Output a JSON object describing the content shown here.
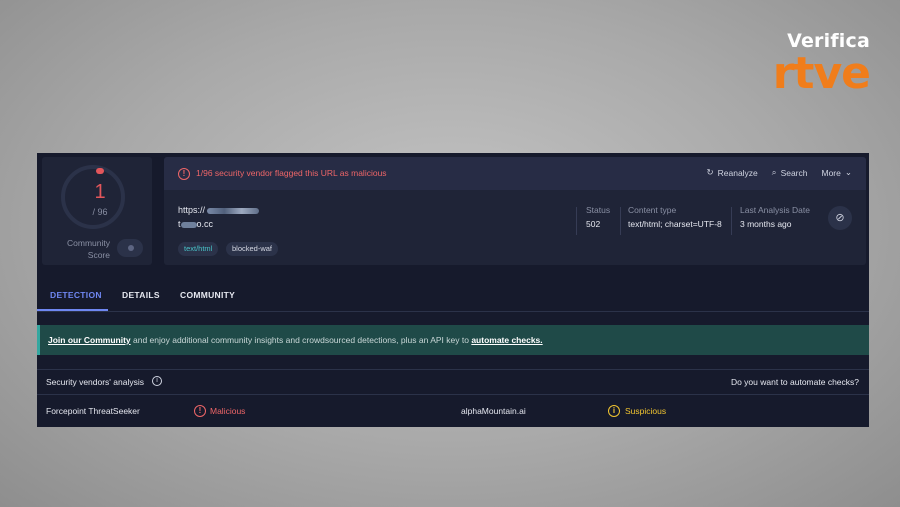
{
  "brand": {
    "line1": "Verifica",
    "line2": "rtve"
  },
  "score": {
    "value": "1",
    "denominator": "/ 96",
    "label_line1": "Community",
    "label_line2": "Score"
  },
  "alert": {
    "icon": "alert-circle-icon",
    "text": "1/96 security vendor flagged this URL as malicious"
  },
  "toolbar": {
    "reanalyze": "Reanalyze",
    "search": "Search",
    "more": "More"
  },
  "url": {
    "line1": "https://",
    "line2_prefix": "t",
    "line2_suffix": "o.cc"
  },
  "tags": [
    "text/html",
    "blocked-waf"
  ],
  "meta": {
    "status_label": "Status",
    "status_value": "502",
    "content_type_label": "Content type",
    "content_type_value": "text/html; charset=UTF-8",
    "last_analysis_label": "Last Analysis Date",
    "last_analysis_value": "3 months ago"
  },
  "tabs": [
    "DETECTION",
    "DETAILS",
    "COMMUNITY"
  ],
  "banner": {
    "link1": "Join our Community",
    "middle": " and enjoy additional community insights and crowdsourced detections, plus an API key to ",
    "link2": "automate checks."
  },
  "vendors": {
    "title": "Security vendors' analysis",
    "automate_question": "Do you want to automate checks?"
  },
  "vendor_row": {
    "vendor1": "Forcepoint ThreatSeeker",
    "result1": "Malicious",
    "vendor2": "alphaMountain.ai",
    "result2": "Suspicious"
  },
  "colors": {
    "malicious": "#ef6668",
    "suspicious": "#f2c530",
    "accent": "#6f87f2",
    "brand_orange": "#f07d1b"
  }
}
